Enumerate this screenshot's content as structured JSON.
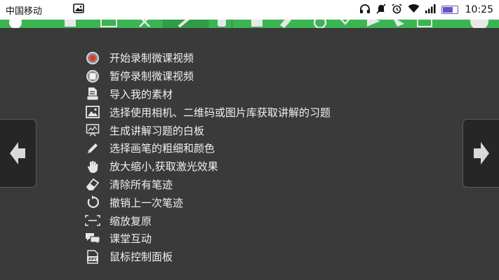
{
  "status_bar": {
    "carrier": "中国移动",
    "time": "10:25",
    "battery_level": 0.7
  },
  "help_items": [
    {
      "icon": "record-icon",
      "label": "开始录制微课视频"
    },
    {
      "icon": "pause-icon",
      "label": "暂停录制微课视频"
    },
    {
      "icon": "import-icon",
      "label": "导入我的素材"
    },
    {
      "icon": "image-icon",
      "label": "选择使用相机、二维码或图片库获取讲解的习题"
    },
    {
      "icon": "whiteboard-icon",
      "label": "生成讲解习题的白板"
    },
    {
      "icon": "pen-icon",
      "label": "选择画笔的粗细和颜色"
    },
    {
      "icon": "hand-icon",
      "label": "放大缩小,获取激光效果"
    },
    {
      "icon": "eraser-icon",
      "label": "清除所有笔迹"
    },
    {
      "icon": "undo-icon",
      "label": "撤销上一次笔迹"
    },
    {
      "icon": "restore-zoom-icon",
      "label": "缩放复原"
    },
    {
      "icon": "chat-icon",
      "label": "课堂互动"
    },
    {
      "icon": "ppt-icon",
      "label": "鼠标控制面板"
    }
  ],
  "nav": {
    "prev_icon": "arrow-left-icon",
    "next_icon": "arrow-right-icon"
  },
  "colors": {
    "toolbar_green": "#3cb452",
    "background": "#3a3a3a",
    "battery": "#6a4fc7"
  }
}
